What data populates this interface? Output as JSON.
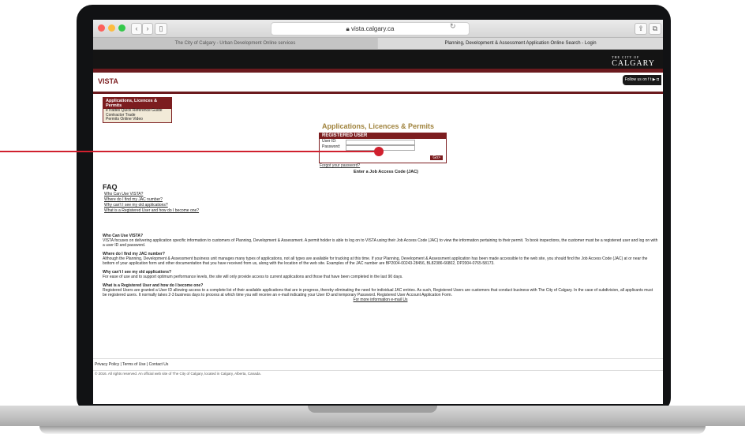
{
  "browser": {
    "url": "vista.calgary.ca",
    "tabs": [
      "The City of Calgary - Urban Development Online services",
      "Planning, Development & Assessment Application Online Search - Login"
    ]
  },
  "site": {
    "logo_small": "THE CITY OF",
    "logo": "CALGARY",
    "vista": "VISTA",
    "follow_us": "Follow us on"
  },
  "sidemenu": {
    "header": "Applications, Licences & Permits",
    "items": [
      "eTrades Quick Reference Guide",
      "Contractor Trade",
      "Permits Online Video"
    ]
  },
  "login": {
    "heading": "Applications, Licences & Permits",
    "box_title": "REGISTERED USER",
    "user_label": "User ID:",
    "password_label": "Password:",
    "go": "Go>",
    "forgot": "Forgot your password?",
    "jac": "Enter a Job Access Code (JAC)"
  },
  "faq": {
    "title": "FAQ",
    "links": [
      "Who Can Use VISTA?",
      "Where do I find my JAC number?",
      "Why can't I see my old applications?",
      "What is a Registered User and how do I become one?"
    ],
    "answers": [
      {
        "q": "Who Can Use VISTA?",
        "a": "VISTA focuses on delivering application specific information to customers of Planning, Development & Assessment. A permit holder is able to log on to VISTA using their Job Access Code (JAC) to view the information pertaining to their permit. To book inspections, the customer must be a registered user and log on with a user ID and password."
      },
      {
        "q": "Where do I find my JAC number?",
        "a": "Although the Planning, Development & Assessment business unit manages many types of applications, not all types are available for tracking at this time. If your Planning, Development & Assessment application has been made accessible to the web site, you should find the Job Access Code (JAC) at or near the bottom of your application form and other documentation that you have received from us, along with the location of the web site. Examples of the JAC number are BP2004-00243-28456, BL82386-66802, DP2004-0765-58173."
      },
      {
        "q": "Why can't I see my old applications?",
        "a": "For ease of use and to support optimum performance levels, the site will only provide access to current applications and those that have been completed in the last 90 days."
      },
      {
        "q": "What is a Registered User and how do I become one?",
        "a": "Registered Users are granted a User ID allowing access to a complete list of their available applications that are in progress, thereby eliminating the need for individual JAC entries. As such, Registered Users are customers that conduct business with The City of Calgary. In the case of subdivision, all applicants must be registered users. It normally takes 2-3 business days to process at which time you will receive an e-mail indicating your User ID and temporary Password. Registered User Account Application Form."
      }
    ],
    "more": "For more information e-mail Us"
  },
  "footer": {
    "links": [
      "Privacy Policy",
      "Terms of Use",
      "Contact Us"
    ],
    "copyright": "© 2016. All rights reserved. An official web site of The City of Calgary, located in Calgary, Alberta, Canada."
  },
  "colors": {
    "brand": "#7c1d1f",
    "accent": "#d0202e",
    "heading": "#a0833d"
  }
}
